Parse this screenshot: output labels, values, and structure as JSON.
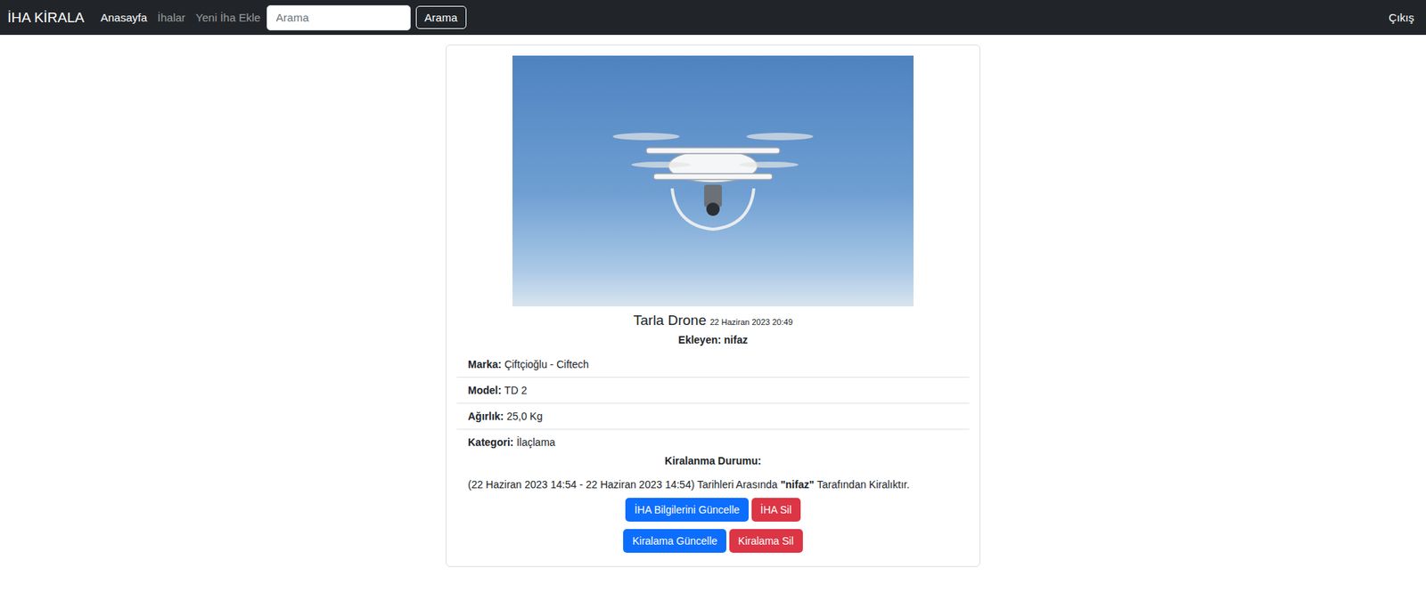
{
  "navbar": {
    "brand": "İHA KİRALA",
    "links": [
      {
        "label": "Anasayfa",
        "selected": true
      },
      {
        "label": "İhalar",
        "selected": false
      },
      {
        "label": "Yeni İha Ekle",
        "selected": false
      }
    ],
    "search": {
      "placeholder": "Arama",
      "button": "Arama"
    },
    "logout": "Çıkış"
  },
  "drone": {
    "title": "Tarla Drone",
    "date": "22 Haziran 2023 20:49",
    "added_by": "Ekleyen: nifaz",
    "details": [
      {
        "label": "Marka:",
        "value": "Çiftçioğlu - Ciftech"
      },
      {
        "label": "Model:",
        "value": "TD 2"
      },
      {
        "label": "Ağırlık:",
        "value": "25,0 Kg"
      },
      {
        "label": "Kategori:",
        "value": "İlaçlama"
      }
    ]
  },
  "rental": {
    "heading": "Kiralanma Durumu:",
    "dates": "(22 Haziran 2023 14:54 - 22 Haziran 2023 14:54) Tarihleri Arasında",
    "user": "\"nifaz\"",
    "suffix": "Tarafından Kiralıktır."
  },
  "button_rows": [
    {
      "buttons": [
        {
          "label": "İHA Bilgilerini Güncelle",
          "kind": "primary"
        },
        {
          "label": "İHA Sil",
          "kind": "danger"
        }
      ]
    },
    {
      "buttons": [
        {
          "label": "Kiralama Güncelle",
          "kind": "primary"
        },
        {
          "label": "Kiralama Sil",
          "kind": "danger"
        }
      ]
    }
  ]
}
